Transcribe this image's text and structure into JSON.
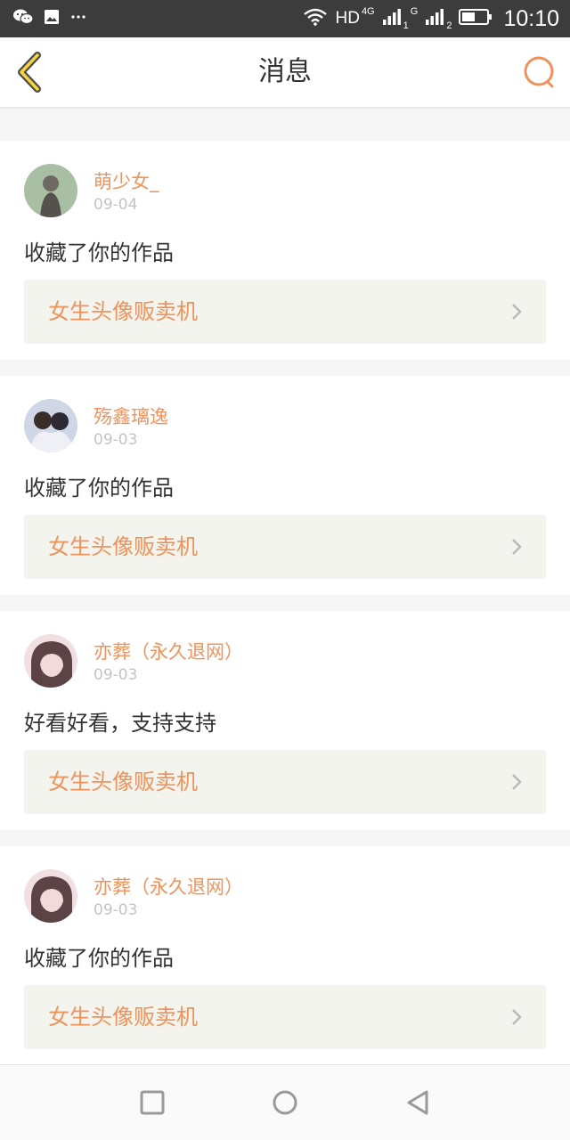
{
  "status_bar": {
    "time": "10:10",
    "network_label": "HD",
    "network_type": "4G",
    "sim1": "1",
    "sim2_type": "G",
    "sim2": "2",
    "left_icons": [
      "wechat-icon",
      "gallery-icon",
      "more-dots-icon"
    ],
    "right_icons": [
      "wifi-icon",
      "signal-icon",
      "signal-icon",
      "battery-icon"
    ]
  },
  "header": {
    "title": "消息",
    "back_icon": "chevron-left-icon",
    "search_icon": "search-icon",
    "accent_color": "#f0925a"
  },
  "messages": [
    {
      "username": "萌少女_",
      "date": "09-04",
      "message": "收藏了你的作品",
      "work_title": "女生头像贩卖机"
    },
    {
      "username": "殇鑫璃逸",
      "date": "09-03",
      "message": "收藏了你的作品",
      "work_title": "女生头像贩卖机"
    },
    {
      "username": "亦葬（永久退网）",
      "date": "09-03",
      "message": "好看好看，支持支持",
      "work_title": "女生头像贩卖机"
    },
    {
      "username": "亦葬（永久退网）",
      "date": "09-03",
      "message": "收藏了你的作品",
      "work_title": "女生头像贩卖机"
    }
  ],
  "nav_bar": {
    "icons": [
      "square-recent-apps-icon",
      "circle-home-icon",
      "triangle-back-icon"
    ]
  }
}
